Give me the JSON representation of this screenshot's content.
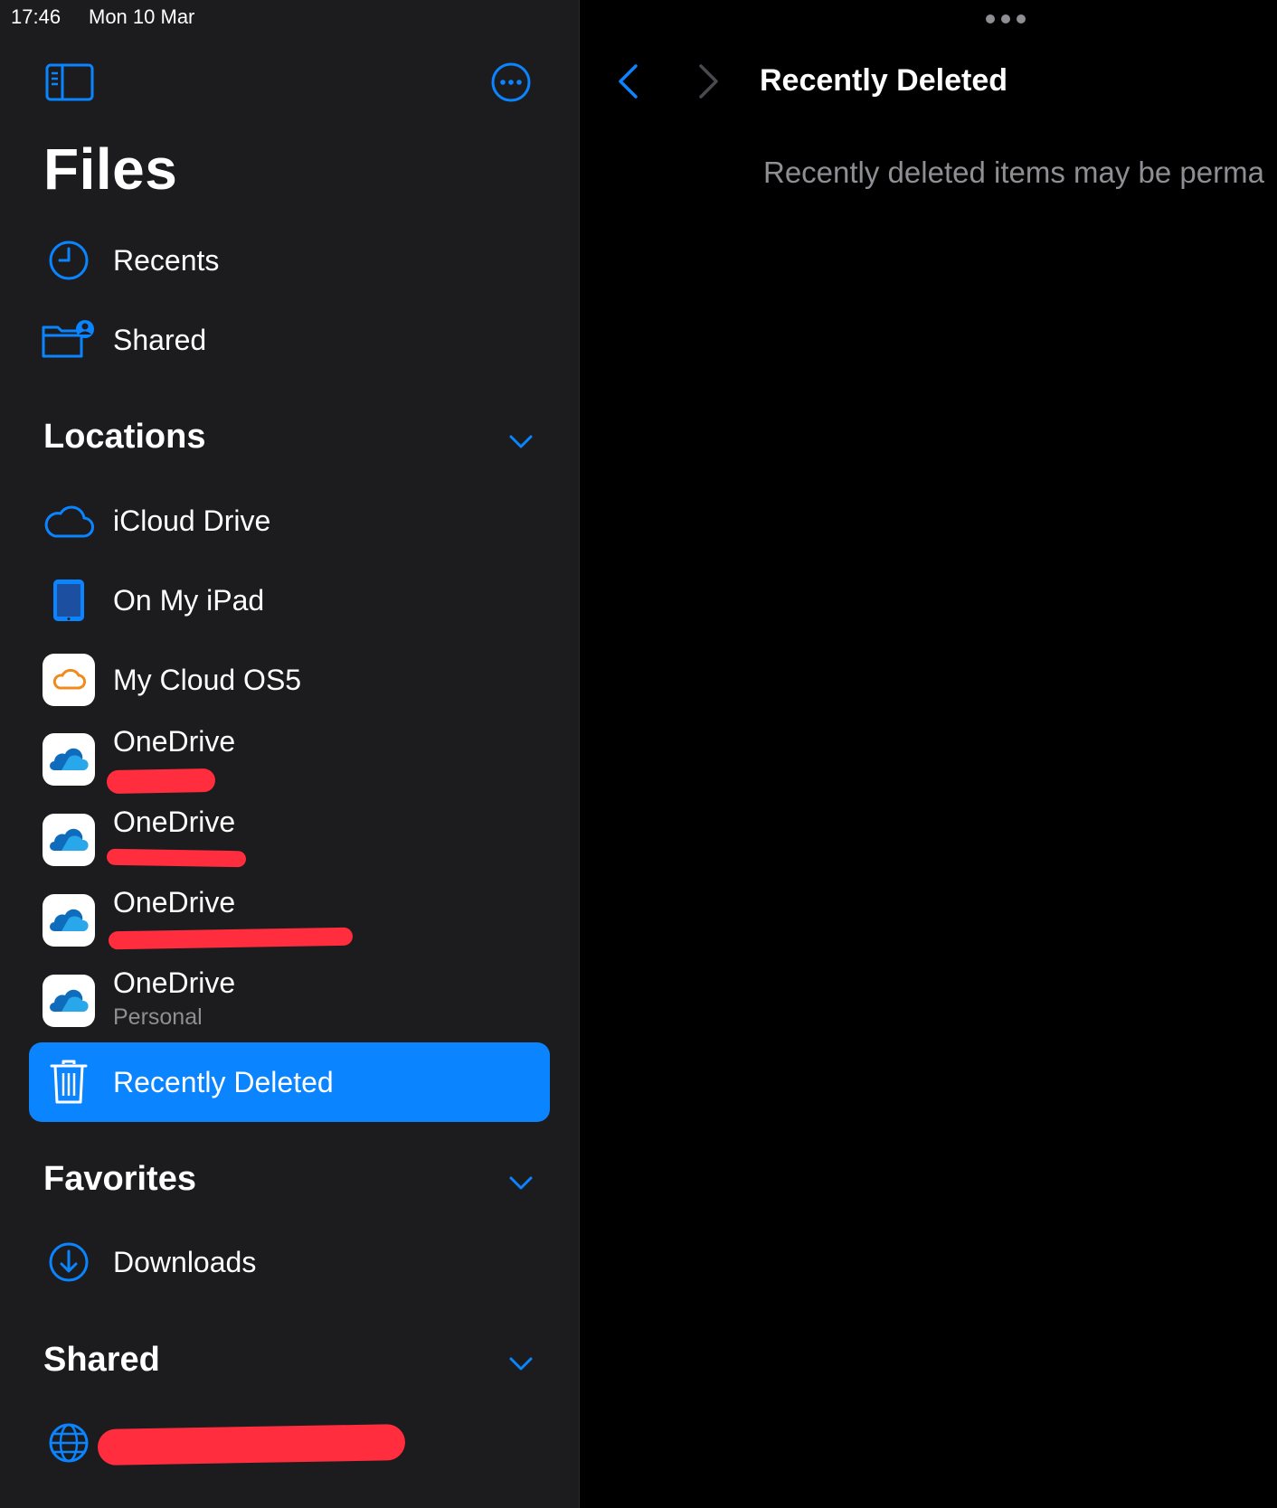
{
  "status_bar": {
    "time": "17:46",
    "date": "Mon 10 Mar"
  },
  "sidebar": {
    "title": "Files",
    "top_items": [
      {
        "label": "Recents",
        "icon": "clock-icon"
      },
      {
        "label": "Shared",
        "icon": "shared-folder-icon"
      }
    ],
    "locations": {
      "header": "Locations",
      "items": [
        {
          "label": "iCloud Drive",
          "icon": "icloud-icon"
        },
        {
          "label": "On My iPad",
          "icon": "ipad-icon"
        },
        {
          "label": "My Cloud OS5",
          "icon": "mycloud-icon"
        },
        {
          "label": "OneDrive",
          "icon": "onedrive-icon"
        },
        {
          "label": "OneDrive",
          "icon": "onedrive-icon"
        },
        {
          "label": "OneDrive",
          "icon": "onedrive-icon"
        },
        {
          "label": "OneDrive",
          "sublabel": "Personal",
          "icon": "onedrive-icon"
        },
        {
          "label": "Recently Deleted",
          "icon": "trash-icon",
          "selected": true
        }
      ]
    },
    "favorites": {
      "header": "Favorites",
      "items": [
        {
          "label": "Downloads",
          "icon": "download-icon"
        }
      ]
    },
    "shared": {
      "header": "Shared"
    }
  },
  "detail": {
    "title": "Recently Deleted",
    "message": "Recently deleted items may be perma"
  },
  "colors": {
    "accent": "#0a84ff",
    "sidebar_bg": "#1c1c1e",
    "redaction": "#ff2d3d"
  }
}
